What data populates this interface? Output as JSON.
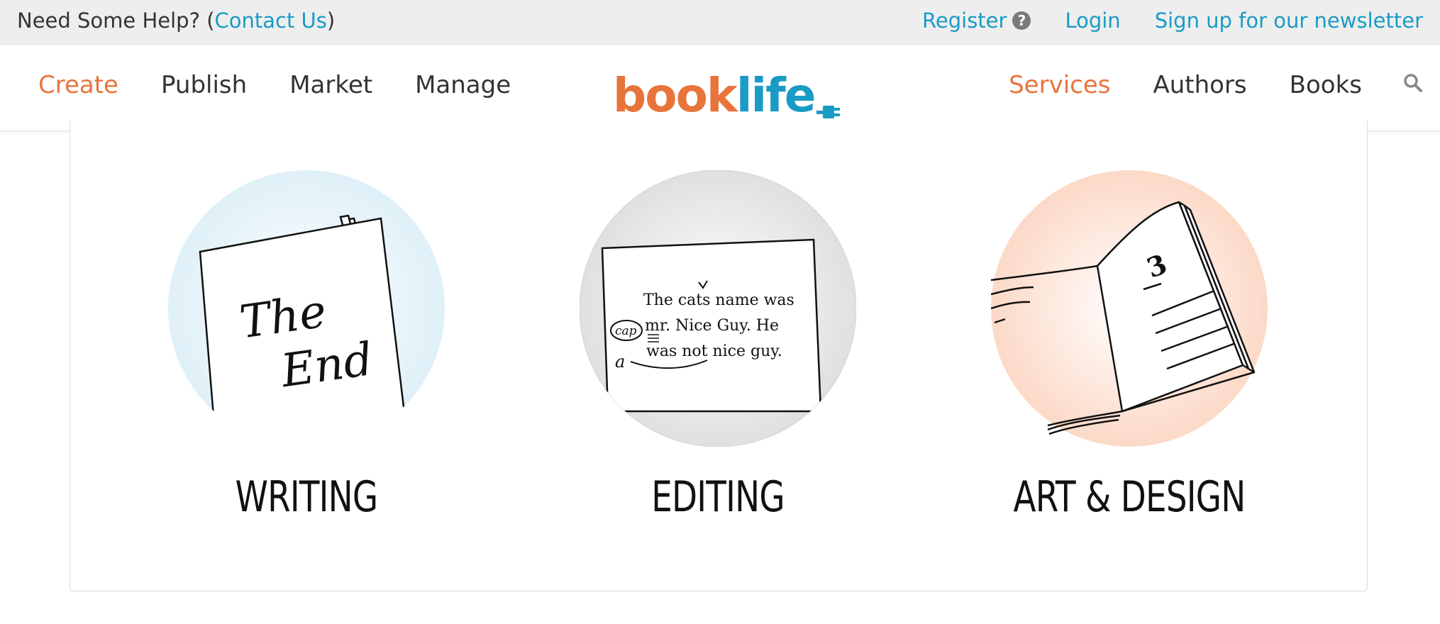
{
  "topbar": {
    "help_prefix": "Need Some Help? (",
    "contact_label": "Contact Us",
    "help_suffix": ")",
    "register_label": "Register",
    "register_icon": "question-circle-icon",
    "login_label": "Login",
    "newsletter_label": "Sign up for our newsletter"
  },
  "nav": {
    "left": [
      {
        "label": "Create",
        "active": true
      },
      {
        "label": "Publish",
        "active": false
      },
      {
        "label": "Market",
        "active": false
      },
      {
        "label": "Manage",
        "active": false
      }
    ],
    "logo": {
      "part1": "book",
      "part2": "life"
    },
    "right": [
      {
        "label": "Services",
        "active": true
      },
      {
        "label": "Authors",
        "active": false
      },
      {
        "label": "Books",
        "active": false
      }
    ],
    "search_icon": "search-icon"
  },
  "services": [
    {
      "title": "WRITING",
      "illustration": "manuscript-the-end",
      "script_line1": "The",
      "script_line2": "End"
    },
    {
      "title": "EDITING",
      "illustration": "proofread-page",
      "line1": "The cats name was",
      "line2": "mr. Nice Guy. He",
      "line3": "was not nice guy.",
      "mark_cap": "cap",
      "mark_a": "a"
    },
    {
      "title": "ART & DESIGN",
      "illustration": "open-book",
      "page_number": "3"
    }
  ],
  "colors": {
    "accent_orange": "#e8743b",
    "link_blue": "#1a9bc6",
    "topbar_bg": "#eeeeee",
    "writing_circle": "#e4f3f9",
    "editing_circle": "#e6e6e6",
    "design_circle": "#fde0d2"
  }
}
